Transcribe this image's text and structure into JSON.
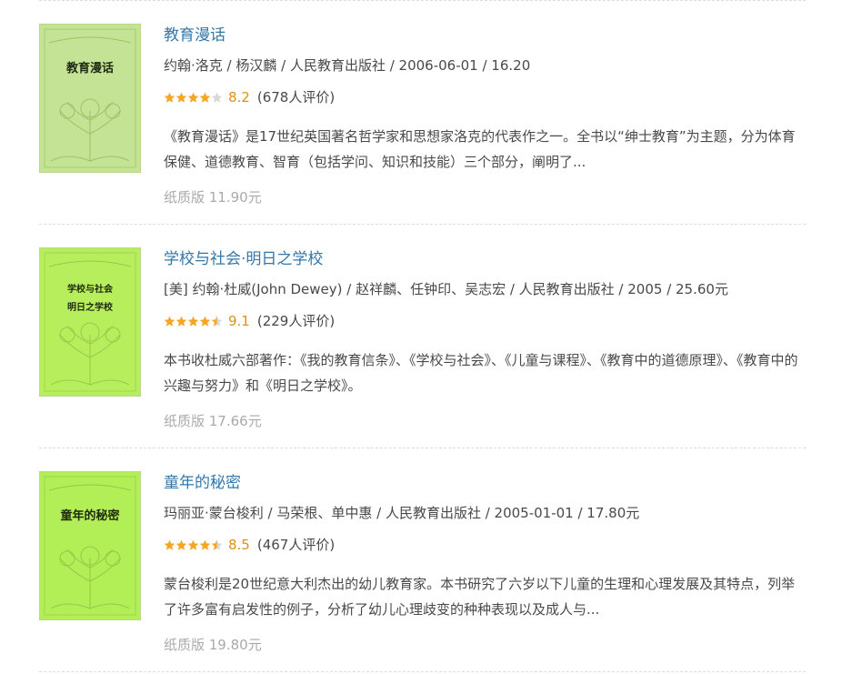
{
  "books": [
    {
      "title": "教育漫话",
      "meta": "约翰·洛克 / 杨汉麟 / 人民教育出版社 / 2006-06-01 / 16.20",
      "rating": 8.2,
      "rating_text": "8.2",
      "rating_count": "(678人评价)",
      "description": "《教育漫话》是17世纪英国著名哲学家和思想家洛克的代表作之一。全书以“绅士教育”为主题，分为体育保健、道德教育、智育（包括学问、知识和技能）三个部分，阐明了...",
      "price": "纸质版 11.90元",
      "cover_title": "教育漫话",
      "cover_color": "#c4e394"
    },
    {
      "title": "学校与社会·明日之学校",
      "meta": "[美] 约翰·杜威(John Dewey) / 赵祥麟、任钟印、吴志宏 / 人民教育出版社 / 2005 / 25.60元",
      "rating": 9.1,
      "rating_text": "9.1",
      "rating_count": "(229人评价)",
      "description": "本书收杜威六部著作：《我的教育信条》、《学校与社会》、《儿童与课程》、《教育中的道德原理》、《教育中的兴趣与努力》和《明日之学校》。",
      "price": "纸质版 17.66元",
      "cover_title": "学校与社会·明日之学校",
      "cover_color": "#b7ee5c"
    },
    {
      "title": "童年的秘密",
      "meta": "玛丽亚·蒙台梭利 / 马荣根、单中惠 / 人民教育出版社 / 2005-01-01 / 17.80元",
      "rating": 8.5,
      "rating_text": "8.5",
      "rating_count": "(467人评价)",
      "description": "蒙台梭利是20世纪意大利杰出的幼儿教育家。本书研究了六岁以下儿童的生理和心理发展及其特点，列举了许多富有启发性的例子，分析了幼儿心理歧变的种种表现以及成人与...",
      "price": "纸质版 19.80元",
      "cover_title": "童年的秘密",
      "cover_color": "#b2ee55"
    }
  ],
  "colors": {
    "title_link": "#3377aa",
    "star_filled": "#f5a623",
    "star_empty": "#d8d8d8",
    "rating_value": "#e09015",
    "price": "#aaaaaa",
    "divider": "#dddddd"
  },
  "icons": {
    "star": "star-icon"
  }
}
